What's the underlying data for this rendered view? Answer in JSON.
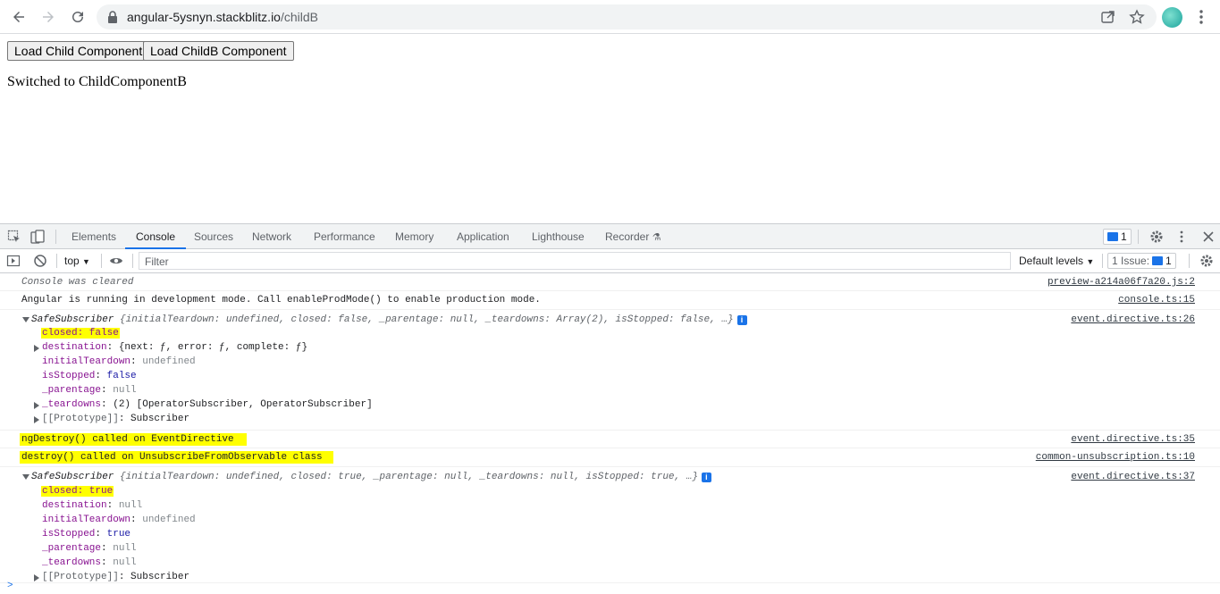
{
  "browser": {
    "url_host": "angular-5ysnyn.stackblitz.io",
    "url_path": "/childB"
  },
  "page": {
    "btn_child": "Load Child Component",
    "btn_childb": "Load ChildB Component",
    "status": "Switched to ChildComponentB"
  },
  "devtools": {
    "tabs": [
      "Elements",
      "Console",
      "Sources",
      "Network",
      "Performance",
      "Memory",
      "Application",
      "Lighthouse",
      "Recorder"
    ],
    "active_tab": "Console",
    "issues_badge_count": "1",
    "context": "top",
    "filter_placeholder": "Filter",
    "levels": "Default levels",
    "issues_label": "1 Issue:",
    "issues_count": "1"
  },
  "console": {
    "cleared": {
      "text": "Console was cleared",
      "src": "preview-a214a06f7a20.js:2"
    },
    "angular": {
      "text": "Angular is running in development mode. Call enableProdMode() to enable production mode.",
      "src": "console.ts:15"
    },
    "sub1": {
      "summary": "{initialTeardown: undefined, closed: false, _parentage: null, _teardowns: Array(2), isStopped: false, …}",
      "name": "SafeSubscriber",
      "src": "event.directive.ts:26",
      "closed": "closed: false",
      "destination_key": "destination",
      "destination_val": "{next: ƒ, error: ƒ, complete: ƒ}",
      "initialTeardown_key": "initialTeardown",
      "initialTeardown_val": "undefined",
      "isStopped_key": "isStopped",
      "isStopped_val": "false",
      "parentage_key": "_parentage",
      "parentage_val": "null",
      "teardowns_key": "_teardowns",
      "teardowns_val": "(2) [OperatorSubscriber, OperatorSubscriber]",
      "proto_key": "[[Prototype]]",
      "proto_val": "Subscriber"
    },
    "ngdestroy": {
      "text": "ngDestroy() called on EventDirective",
      "src": "event.directive.ts:35"
    },
    "destroy": {
      "text": "destroy() called on UnsubscribeFromObservable class",
      "src": "common-unsubscription.ts:10"
    },
    "sub2": {
      "summary": "{initialTeardown: undefined, closed: true, _parentage: null, _teardowns: null, isStopped: true, …}",
      "name": "SafeSubscriber",
      "src": "event.directive.ts:37",
      "closed": "closed: true",
      "destination_key": "destination",
      "destination_val": "null",
      "initialTeardown_key": "initialTeardown",
      "initialTeardown_val": "undefined",
      "isStopped_key": "isStopped",
      "isStopped_val": "true",
      "parentage_key": "_parentage",
      "parentage_val": "null",
      "teardowns_key": "_teardowns",
      "teardowns_val": "null",
      "proto_key": "[[Prototype]]",
      "proto_val": "Subscriber"
    },
    "prompt": ">"
  }
}
